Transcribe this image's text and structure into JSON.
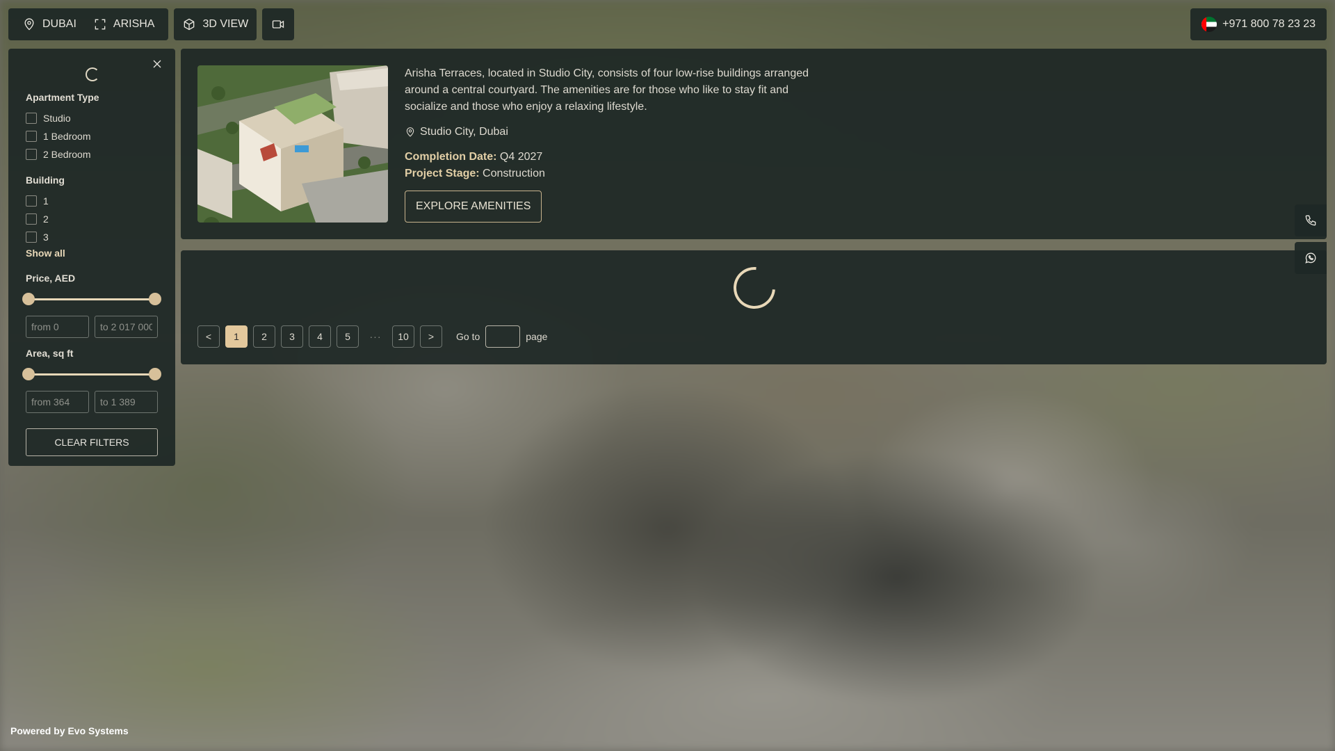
{
  "topbar": {
    "city_label": "DUBAI",
    "project_label": "ARISHA",
    "view_label": "3D VIEW"
  },
  "contact": {
    "phone": "+971 800 78 23 23"
  },
  "filters": {
    "apartment_type": {
      "title": "Apartment Type",
      "options": [
        "Studio",
        "1 Bedroom",
        "2 Bedroom"
      ]
    },
    "building": {
      "title": "Building",
      "options": [
        "1",
        "2",
        "3"
      ],
      "show_all": "Show all"
    },
    "price": {
      "title": "Price, AED",
      "from_placeholder": "from 0",
      "to_placeholder": "to 2 017 000",
      "min_fraction": 0.0,
      "max_fraction": 1.0
    },
    "area": {
      "title": "Area, sq ft",
      "from_placeholder": "from 364",
      "to_placeholder": "to 1 389",
      "min_fraction": 0.0,
      "max_fraction": 1.0
    },
    "clear_label": "CLEAR FILTERS"
  },
  "project": {
    "description": "Arisha Terraces, located in Studio City, consists of four low-rise buildings arranged around a central courtyard. The amenities are for those who like to stay fit and socialize and those who enjoy a relaxing lifestyle.",
    "location": "Studio City, Dubai",
    "completion_label": "Completion Date:",
    "completion_value": "Q4 2027",
    "stage_label": "Project Stage:",
    "stage_value": "Construction",
    "explore_label": "EXPLORE AMENITIES"
  },
  "pagination": {
    "prev": "<",
    "next": ">",
    "pages": [
      "1",
      "2",
      "3",
      "4",
      "5"
    ],
    "ellipsis": "···",
    "last": "10",
    "current": "1",
    "goto_label": "Go to",
    "page_label": "page"
  },
  "footer": {
    "powered_by": "Powered by Evo Systems"
  },
  "colors": {
    "accent": "#e3c89c",
    "panel": "#1e2826"
  }
}
